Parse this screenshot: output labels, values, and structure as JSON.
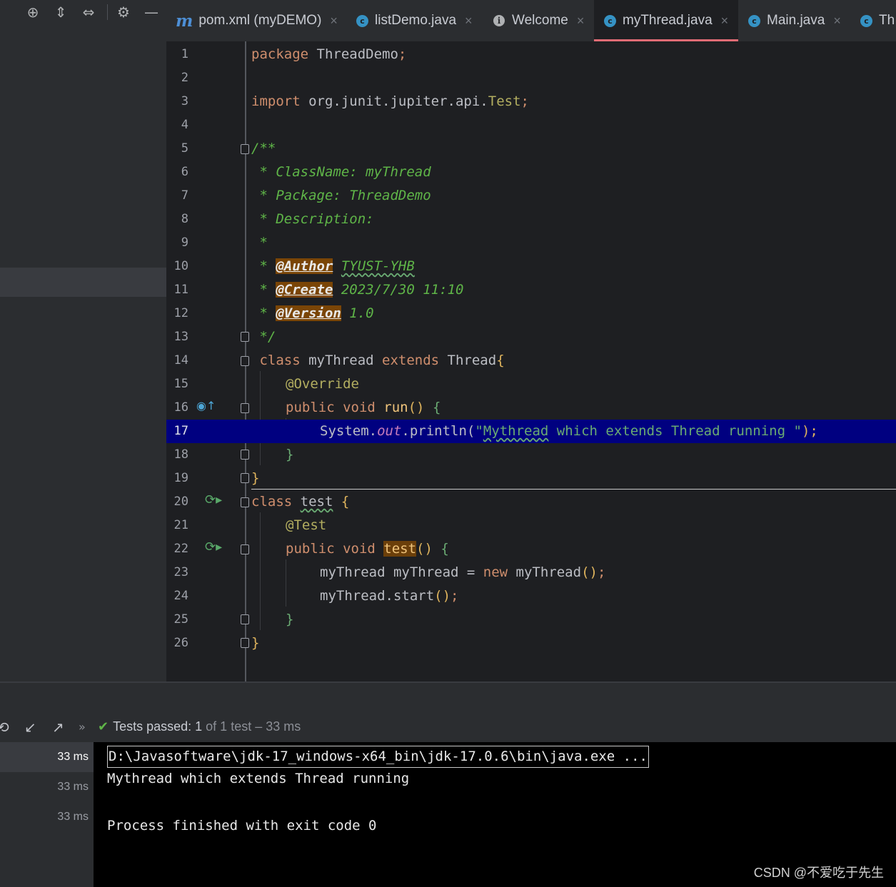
{
  "toolbar": {
    "icons": [
      "locate-icon",
      "expand-all-icon",
      "collapse-all-icon",
      "gear-icon",
      "minimize-icon"
    ],
    "glyphs": [
      "⊕",
      "⇕",
      "⇔",
      "⚙",
      "—"
    ]
  },
  "tabs": [
    {
      "label": "pom.xml (myDEMO)",
      "icon": "maven-icon",
      "glyph": "m",
      "active": false
    },
    {
      "label": "listDemo.java",
      "icon": "java-class-icon",
      "glyph": "c",
      "active": false
    },
    {
      "label": "Welcome",
      "icon": "info-icon",
      "glyph": "i",
      "active": false
    },
    {
      "label": "myThread.java",
      "icon": "java-class-icon",
      "glyph": "c",
      "active": true
    },
    {
      "label": "Main.java",
      "icon": "java-class-icon",
      "glyph": "c",
      "active": false
    },
    {
      "label": "Th",
      "icon": "java-class-icon",
      "glyph": "c",
      "active": false
    }
  ],
  "tab_close_glyph": "×",
  "editor": {
    "file": "myThread.java",
    "highlighted_line": 17,
    "line_numbers": [
      "1",
      "2",
      "3",
      "4",
      "5",
      "6",
      "7",
      "8",
      "9",
      "10",
      "11",
      "12",
      "13",
      "14",
      "15",
      "16",
      "17",
      "18",
      "19",
      "20",
      "21",
      "22",
      "23",
      "24",
      "25",
      "26"
    ],
    "code": {
      "l1_kw": "package",
      "l1_rest": " ThreadDemo",
      "l1_semi": ";",
      "l3_kw": "import",
      "l3_rest": " org.junit.jupiter.api.",
      "l3_cls": "Test",
      "l3_semi": ";",
      "l5": "/**",
      "l6": " * ClassName: myThread",
      "l7": " * Package: ThreadDemo",
      "l8": " * Description:",
      "l9": " *",
      "l10_star": " * ",
      "l10_tag": "@Author",
      "l10_val": "TYUST-YHB",
      "l11_star": " * ",
      "l11_tag": "@Create",
      "l11_val": " 2023/7/30 11:10",
      "l12_star": " * ",
      "l12_tag": "@Version",
      "l12_val": " 1.0",
      "l13": " */",
      "l14_kw1": " class",
      "l14_name": " myThread ",
      "l14_kw2": "extends",
      "l14_sup": " Thread",
      "l14_br": "{",
      "l15": "@Override",
      "l16_kw": "public void ",
      "l16_fn": "run",
      "l16_par": "() ",
      "l16_br": "{",
      "l17_sys": "System.",
      "l17_out": "out",
      "l17_pr": ".println(",
      "l17_str1": "\"",
      "l17_strw": "Mythread",
      "l17_str2": " which extends Thread running \"",
      "l17_end": ");",
      "l18": "}",
      "l19": "}",
      "l20_kw": "class ",
      "l20_name": "test",
      "l20_br": " {",
      "l21": "@Test",
      "l22_kw": "public void ",
      "l22_fn": "test",
      "l22_par": "() ",
      "l22_br": "{",
      "l23_a": "myThread myThread = ",
      "l23_kw": "new",
      "l23_b": " myThread",
      "l23_par": "()",
      "l23_semi": ";",
      "l24_a": "myThread.start",
      "l24_par": "()",
      "l24_semi": ";",
      "l25": "}",
      "l26": "}"
    }
  },
  "run_panel": {
    "header_icons": [
      "history-icon",
      "import-tests-icon",
      "export-tests-icon",
      "more-chevron-icon"
    ],
    "header_glyphs": [
      "⟲",
      "↙",
      "↗",
      "»"
    ],
    "status_check": "✔",
    "status_label": "Tests passed: ",
    "status_count": "1",
    "status_rest": " of 1 test – 33 ms",
    "tree_rows": [
      "33 ms",
      "33 ms",
      "33 ms"
    ],
    "console_lines": [
      "D:\\Javasoftware\\jdk-17_windows-x64_bin\\jdk-17.0.6\\bin\\java.exe ...",
      "Mythread which extends Thread running",
      "",
      "Process finished with exit code 0"
    ]
  },
  "watermark": "CSDN @不爱吃于先生",
  "colors": {
    "background": "#1e1f22",
    "panel": "#2b2d30",
    "keyword": "#cf8e6d",
    "comment": "#5fb548",
    "string": "#6aab73",
    "highlight_line": "#000080",
    "active_tab_underline": "#e06c75"
  }
}
